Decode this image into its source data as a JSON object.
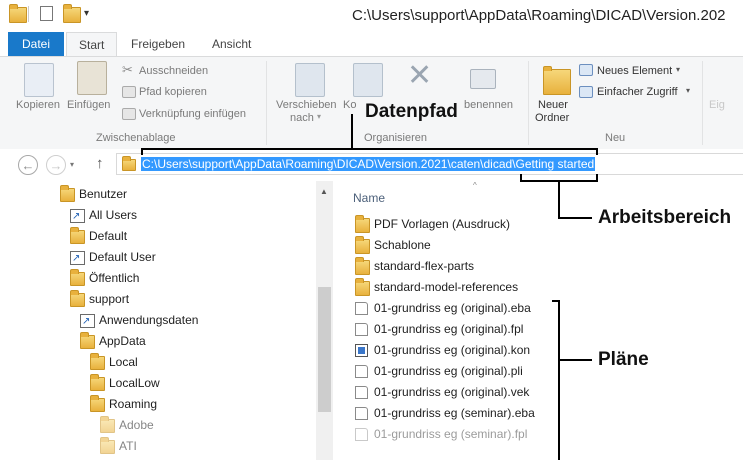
{
  "window": {
    "title": "C:\\Users\\support\\AppData\\Roaming\\DICAD\\Version.202"
  },
  "ribbon_tabs": [
    "Datei",
    "Start",
    "Freigeben",
    "Ansicht"
  ],
  "ribbon": {
    "copy": "Kopieren",
    "paste": "Einfügen",
    "cut": "Ausschneiden",
    "copy_path": "Pfad kopieren",
    "paste_link": "Verknüpfung einfügen",
    "group_clipboard": "Zwischenablage",
    "move_to_l1": "Verschieben",
    "move_to_l2": "nach",
    "copy_to_partial": "Ko",
    "rename_partial": "benennen",
    "group_organize": "Organisieren",
    "new_folder_l1": "Neuer",
    "new_folder_l2": "Ordner",
    "new_item": "Neues Element",
    "easy_access": "Einfacher Zugriff",
    "group_new": "Neu",
    "properties_partial": "Eig"
  },
  "address": {
    "path": "C:\\Users\\support\\AppData\\Roaming\\DICAD\\Version.2021\\caten\\dicad\\Getting started"
  },
  "tree": [
    {
      "label": "Benutzer",
      "type": "folder"
    },
    {
      "label": "All Users",
      "type": "shortcut"
    },
    {
      "label": "Default",
      "type": "folder"
    },
    {
      "label": "Default User",
      "type": "shortcut"
    },
    {
      "label": "Öffentlich",
      "type": "folder"
    },
    {
      "label": "support",
      "type": "folder"
    },
    {
      "label": "Anwendungsdaten",
      "type": "shortcut"
    },
    {
      "label": "AppData",
      "type": "folder"
    },
    {
      "label": "Local",
      "type": "folder"
    },
    {
      "label": "LocalLow",
      "type": "folder"
    },
    {
      "label": "Roaming",
      "type": "folder"
    },
    {
      "label": "Adobe",
      "type": "folder"
    },
    {
      "label": "ATI",
      "type": "folder"
    }
  ],
  "file_list": {
    "column_name": "Name",
    "items": [
      {
        "label": "PDF Vorlagen (Ausdruck)",
        "type": "folder"
      },
      {
        "label": "Schablone",
        "type": "folder"
      },
      {
        "label": "standard-flex-parts",
        "type": "folder"
      },
      {
        "label": "standard-model-references",
        "type": "folder"
      },
      {
        "label": "01-grundriss eg (original).eba",
        "type": "doc"
      },
      {
        "label": "01-grundriss eg (original).fpl",
        "type": "doc"
      },
      {
        "label": "01-grundriss eg (original).kon",
        "type": "kon"
      },
      {
        "label": "01-grundriss eg (original).pli",
        "type": "doc"
      },
      {
        "label": "01-grundriss eg (original).vek",
        "type": "doc"
      },
      {
        "label": "01-grundriss eg (seminar).eba",
        "type": "doc"
      },
      {
        "label": "01-grundriss eg (seminar).fpl",
        "type": "doc"
      }
    ]
  },
  "annotations": {
    "data_path": "Datenpfad",
    "work_area": "Arbeitsbereich",
    "plans": "Pläne"
  }
}
